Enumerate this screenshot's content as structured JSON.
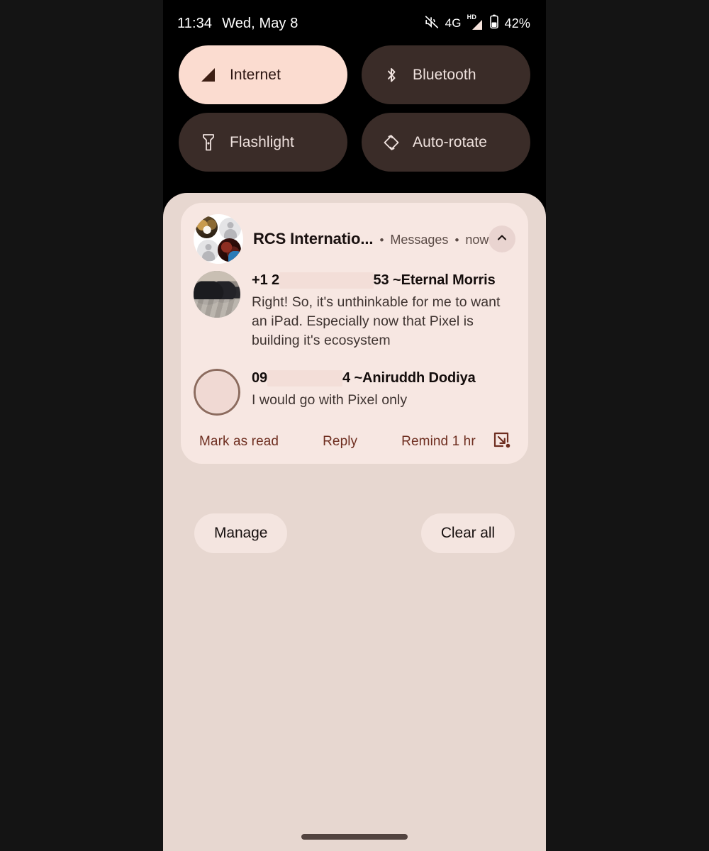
{
  "status_bar": {
    "time": "11:34",
    "date": "Wed, May 8",
    "mute_icon": "volume-off-icon",
    "network_type": "4G",
    "hd_label": "HD",
    "signal_icon": "signal-bars-icon",
    "battery_icon": "battery-icon",
    "battery_percent": "42%"
  },
  "quick_settings": {
    "tiles": [
      {
        "label": "Internet",
        "icon": "signal-triangle-icon",
        "state": "on"
      },
      {
        "label": "Bluetooth",
        "icon": "bluetooth-icon",
        "state": "off"
      },
      {
        "label": "Flashlight",
        "icon": "flashlight-icon",
        "state": "off"
      },
      {
        "label": "Auto-rotate",
        "icon": "auto-rotate-icon",
        "state": "off"
      }
    ]
  },
  "notification": {
    "app_title": "RCS Internatio...",
    "separator_1": "•",
    "app_name": "Messages",
    "separator_2": "•",
    "time": "now",
    "collapse_icon": "chevron-up-icon",
    "group_avatar": "group-avatar-icon",
    "messages": [
      {
        "sender_prefix": "+1 2",
        "sender_redacted": "XXXXXXXXXX",
        "sender_suffix": "53 ~Eternal Morris",
        "text": "Right! So, it's unthinkable for me to want an iPad. Especially now that Pixel is building it's ecosystem",
        "avatar": "car-photo-avatar"
      },
      {
        "sender_prefix": "09",
        "sender_redacted": "XXXXXXXX",
        "sender_suffix": "4 ~Aniruddh Dodiya",
        "text": "I would go with Pixel only",
        "avatar": "ring-avatar"
      }
    ],
    "actions": [
      {
        "label": "Mark as read"
      },
      {
        "label": "Reply"
      },
      {
        "label": "Remind 1 hr"
      }
    ],
    "bubble_icon": "open-in-bubble-icon"
  },
  "shade_buttons": {
    "manage": "Manage",
    "clear_all": "Clear all"
  },
  "nav": {
    "home_indicator": "home-indicator"
  },
  "colors": {
    "accent_tile_on": "#FBDCD0",
    "tile_off": "#3A2C28",
    "shade_bg": "#E7D7D0",
    "notification_bg": "#F7E7E2",
    "action_text": "#6E2E20"
  }
}
